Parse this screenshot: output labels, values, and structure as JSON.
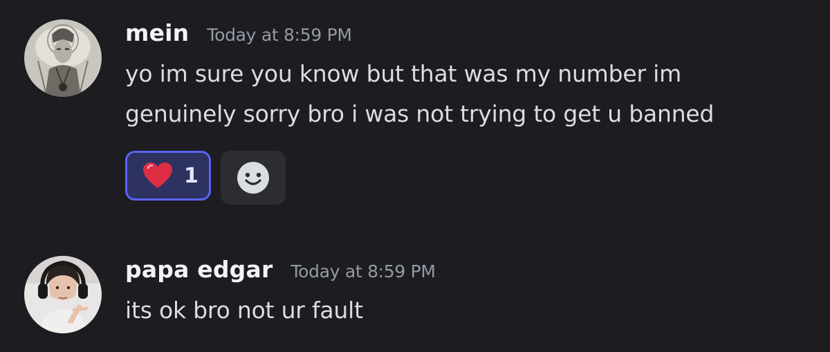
{
  "messages": [
    {
      "username": "mein",
      "timestamp": "Today at 8:59 PM",
      "lines": [
        "yo im sure you know but that was my number im",
        "genuinely sorry bro i was not trying to get u banned"
      ],
      "reactions": [
        {
          "emoji": "red-heart",
          "count": "1",
          "selected": true
        }
      ]
    },
    {
      "username": "papa edgar",
      "timestamp": "Today at 8:59 PM",
      "lines": [
        "its ok bro not ur fault"
      ]
    }
  ],
  "colors": {
    "background": "#1c1c21",
    "username": "#f2f3f5",
    "timestamp": "#949ba4",
    "message_text": "#dbdee1",
    "reaction_border": "#5865f2",
    "reaction_bg": "#2e3261",
    "add_reaction_bg": "#2b2d31"
  },
  "icons": {
    "reaction_emoji": "heart-icon",
    "add_reaction": "smiley-face-icon"
  }
}
